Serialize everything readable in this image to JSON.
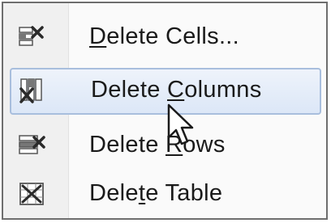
{
  "context_menu": {
    "items": [
      {
        "pre": "",
        "mnemonic": "D",
        "post": "elete Cells...",
        "icon": "delete-cells-icon",
        "state": "normal"
      },
      {
        "pre": "Delete ",
        "mnemonic": "C",
        "post": "olumns",
        "icon": "delete-columns-icon",
        "state": "hover"
      },
      {
        "pre": "Delete ",
        "mnemonic": "R",
        "post": "ows",
        "icon": "delete-rows-icon",
        "state": "normal"
      },
      {
        "pre": "Dele",
        "mnemonic": "t",
        "post": "e Table",
        "icon": "delete-table-icon",
        "state": "normal"
      }
    ]
  },
  "cursor": "arrow-pointer-icon",
  "colors": {
    "hover_fill": "#dce7f7",
    "hover_border": "#a8bedd",
    "delete_x": "#2a2a2a"
  }
}
